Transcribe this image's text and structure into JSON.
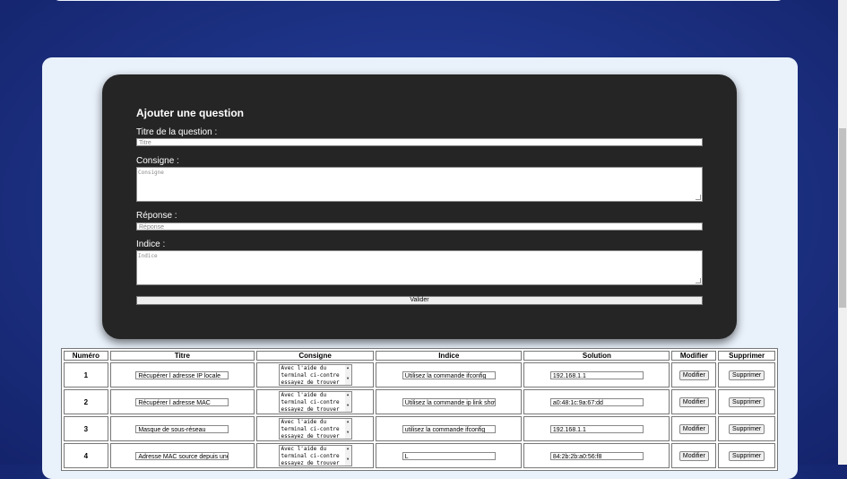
{
  "form": {
    "title": "Ajouter une question",
    "title_label": "Titre de la question :",
    "title_placeholder": "Titre",
    "consigne_label": "Consigne :",
    "consigne_placeholder": "Consigne",
    "reponse_label": "Réponse :",
    "reponse_placeholder": "Réponse",
    "indice_label": "Indice :",
    "indice_placeholder": "Indice",
    "submit_label": "Valider"
  },
  "table": {
    "headers": [
      "Numéro",
      "Titre",
      "Consigne",
      "Indice",
      "Solution",
      "Modifier",
      "Supprimer"
    ],
    "modify_label": "Modifier",
    "delete_label": "Supprimer",
    "rows": [
      {
        "num": "1",
        "titre": "Récupérer l adresse IP locale",
        "consigne": "Avec l'aide du terminal ci-contre essayez de trouver",
        "indice": "Utilisez la commande ifconfig",
        "solution": "192.168.1.1"
      },
      {
        "num": "2",
        "titre": "Récupérer l adresse MAC",
        "consigne": "Avec l'aide du terminal ci-contre essayez de trouver",
        "indice": "Utilisez la commande ip link show",
        "solution": "a0:48:1c:9a:67:dd"
      },
      {
        "num": "3",
        "titre": "Masque de sous-réseau",
        "consigne": "Avec l'aide du terminal ci-contre essayez de trouver",
        "indice": "utilisez la commande ifconfig",
        "solution": "192.168.1.1"
      },
      {
        "num": "4",
        "titre": "Adresse MAC source depuis une t",
        "consigne": " Avec l'aide du terminal ci-contre essayez de trouver",
        "indice": "L",
        "solution": "84:2b:2b:a0:56:f8"
      }
    ]
  },
  "colors": {
    "background": "#1e3488",
    "panel": "#e9f1fb",
    "card": "#252525"
  }
}
